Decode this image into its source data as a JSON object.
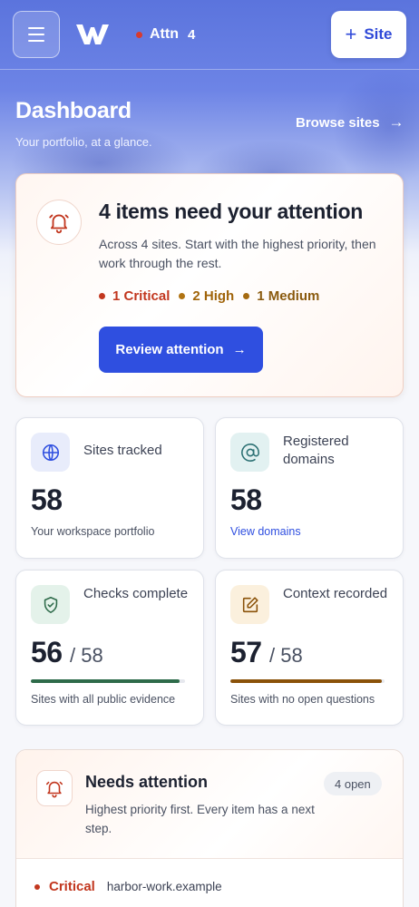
{
  "topbar": {
    "menu_icon": "hamburger-icon",
    "logo_icon": "w-logo-icon",
    "attention": {
      "label": "Attn",
      "count": "4"
    },
    "add_site": {
      "icon": "plus-icon",
      "label": "Site"
    }
  },
  "header": {
    "title": "Dashboard",
    "subtitle": "Your portfolio, at a glance.",
    "browse_link": "Browse sites",
    "browse_icon": "arrow-right-icon"
  },
  "attention_card": {
    "icon": "bell-icon",
    "title": "4 items need your attention",
    "description": "Across 4 sites. Start with the highest priority, then work through the rest.",
    "priorities": [
      {
        "label": "1 Critical",
        "color": "#c2371f"
      },
      {
        "label": "2 High",
        "color": "#b07312"
      },
      {
        "label": "1 Medium",
        "color": "#a56a11"
      }
    ],
    "button_label": "Review attention"
  },
  "stats": {
    "sites": {
      "icon": "globe-icon",
      "label": "Sites tracked",
      "value": "58",
      "footer": "Your workspace portfolio"
    },
    "domains": {
      "icon": "at-sign-icon",
      "label": "Registered domains",
      "value": "58",
      "link": "View domains"
    },
    "checks": {
      "icon": "shield-check-icon",
      "label": "Checks complete",
      "value": "56",
      "total": "/ 58",
      "progress": 0.966,
      "bar_color": "#2e6b4a",
      "footer": "Sites with all public evidence"
    },
    "context": {
      "icon": "edit-icon",
      "label": "Context recorded",
      "value": "57",
      "total": "/ 58",
      "progress": 0.983,
      "bar_color": "#8a5209",
      "footer": "Sites with no open questions"
    }
  },
  "needs_attention": {
    "icon": "bell-icon",
    "title": "Needs attention",
    "description": "Highest priority first. Every item has a next step.",
    "badge": "4 open",
    "items": [
      {
        "severity": "Critical",
        "domain": "harbor-work.example"
      }
    ]
  },
  "colors": {
    "accent": "#2f4fe0",
    "critical": "#c2371f"
  }
}
